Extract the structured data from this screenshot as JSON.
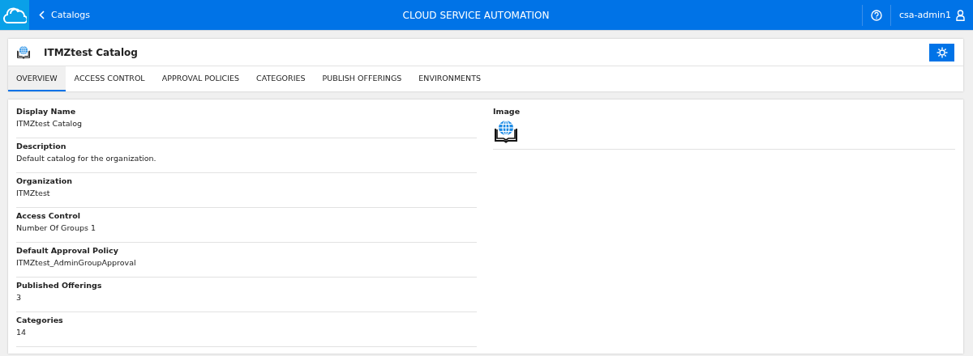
{
  "header": {
    "back_link": "Catalogs",
    "title": "CLOUD SERVICE AUTOMATION",
    "user": "csa-admin1"
  },
  "catalog": {
    "title": "ITMZtest Catalog"
  },
  "tabs": [
    {
      "label": "OVERVIEW",
      "selected": true
    },
    {
      "label": "ACCESS CONTROL",
      "selected": false
    },
    {
      "label": "APPROVAL POLICIES",
      "selected": false
    },
    {
      "label": "CATEGORIES",
      "selected": false
    },
    {
      "label": "PUBLISH OFFERINGS",
      "selected": false
    },
    {
      "label": "ENVIRONMENTS",
      "selected": false
    }
  ],
  "fields": [
    {
      "label": "Display Name",
      "value": "ITMZtest Catalog"
    },
    {
      "label": "Description",
      "value": "Default catalog for the organization."
    },
    {
      "label": "Organization",
      "value": "ITMZtest"
    },
    {
      "label": "Access Control",
      "value": "Number Of Groups 1"
    },
    {
      "label": "Default Approval Policy",
      "value": "ITMZtest_AdminGroupApproval"
    },
    {
      "label": "Published Offerings",
      "value": "3"
    },
    {
      "label": "Categories",
      "value": "14"
    }
  ],
  "image_field": {
    "label": "Image"
  }
}
